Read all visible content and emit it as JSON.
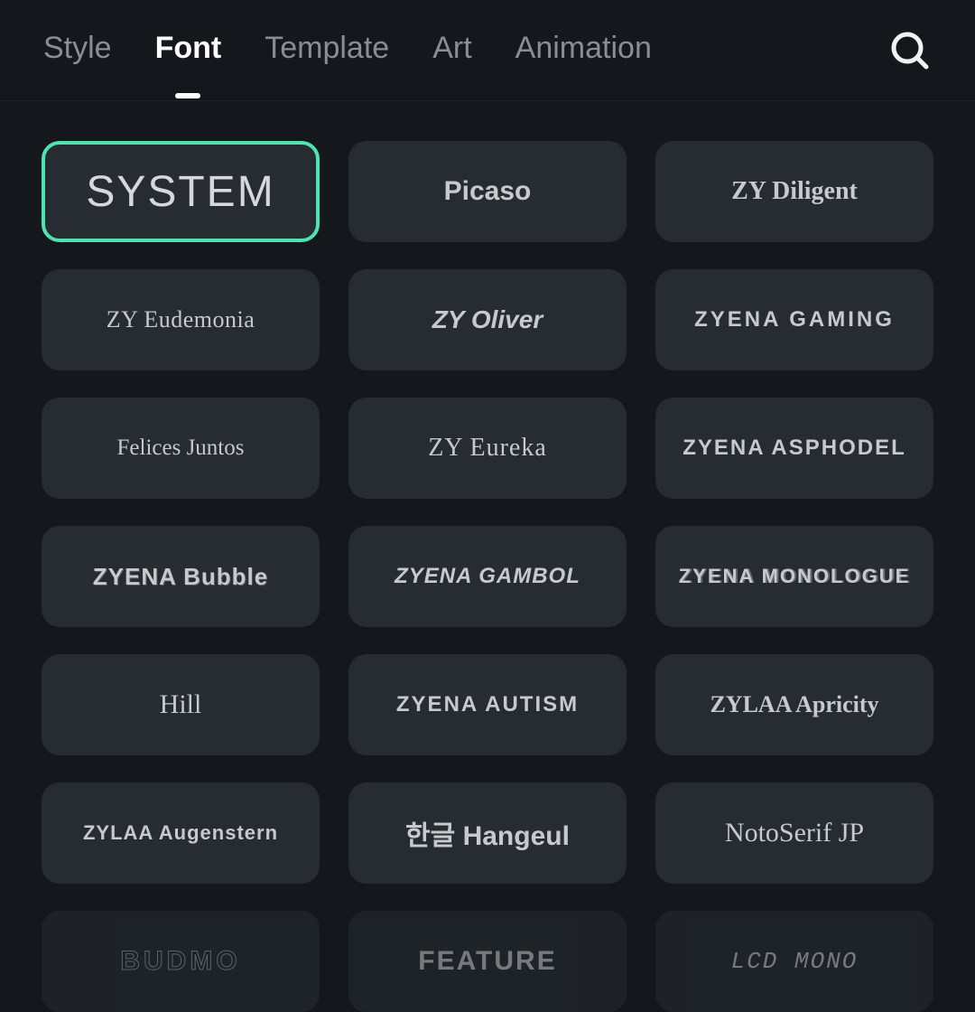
{
  "header": {
    "tabs": [
      {
        "label": "Style",
        "active": false
      },
      {
        "label": "Font",
        "active": true
      },
      {
        "label": "Template",
        "active": false
      },
      {
        "label": "Art",
        "active": false
      },
      {
        "label": "Animation",
        "active": false
      }
    ]
  },
  "fonts": [
    {
      "label": "SYSTEM",
      "selected": true,
      "styleClass": ""
    },
    {
      "label": "Picaso",
      "selected": false,
      "styleClass": "f-picaso"
    },
    {
      "label": "ZY Diligent",
      "selected": false,
      "styleClass": "f-diligent"
    },
    {
      "label": "ZY Eudemonia",
      "selected": false,
      "styleClass": "f-eudemonia"
    },
    {
      "label": "ZY Oliver",
      "selected": false,
      "styleClass": "f-oliver"
    },
    {
      "label": "ZYENA GAMING",
      "selected": false,
      "styleClass": "f-gaming"
    },
    {
      "label": "Felices Juntos",
      "selected": false,
      "styleClass": "f-felices"
    },
    {
      "label": "ZY Eureka",
      "selected": false,
      "styleClass": "f-eureka"
    },
    {
      "label": "ZYENA ASPHODEL",
      "selected": false,
      "styleClass": "f-asphodel"
    },
    {
      "label": "ZYENA Bubble",
      "selected": false,
      "styleClass": "f-bubble"
    },
    {
      "label": "ZYENA GAMBOL",
      "selected": false,
      "styleClass": "f-gambol"
    },
    {
      "label": "ZYENA MONOLOGUE",
      "selected": false,
      "styleClass": "f-monologue"
    },
    {
      "label": "Hill",
      "selected": false,
      "styleClass": "f-hill"
    },
    {
      "label": "ZYENA AUTISM",
      "selected": false,
      "styleClass": "f-autism"
    },
    {
      "label": "ZYLAA Apricity",
      "selected": false,
      "styleClass": "f-apricity"
    },
    {
      "label": "ZYLAA Augenstern",
      "selected": false,
      "styleClass": "f-augenstern"
    },
    {
      "label": "한글 Hangeul",
      "selected": false,
      "styleClass": "f-hangeul"
    },
    {
      "label": "NotoSerif JP",
      "selected": false,
      "styleClass": "f-noto"
    },
    {
      "label": "BUDMO",
      "selected": false,
      "styleClass": "f-budmo",
      "partial": true
    },
    {
      "label": "FEATURE",
      "selected": false,
      "styleClass": "f-feature",
      "partial": true
    },
    {
      "label": "LCD MONO",
      "selected": false,
      "styleClass": "f-lcd",
      "partial": true
    }
  ]
}
